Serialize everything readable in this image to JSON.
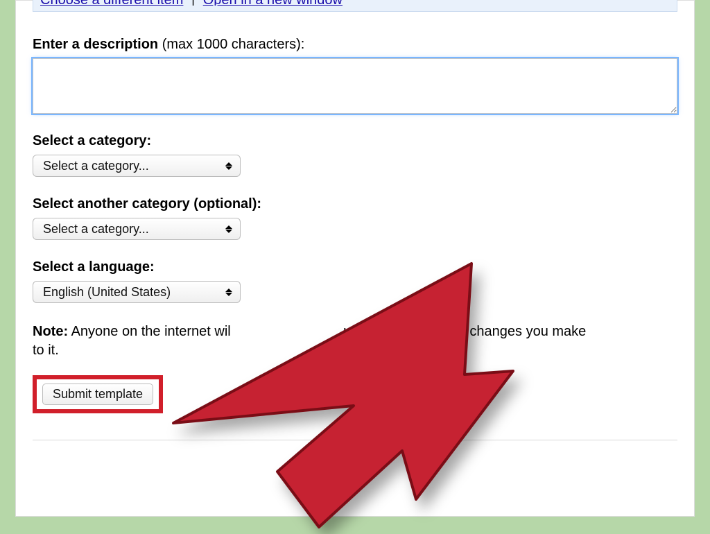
{
  "top_links": {
    "choose": "Choose a different item",
    "sep": "|",
    "open": "Open in a new window"
  },
  "description": {
    "label_bold": "Enter a description",
    "label_hint": " (max 1000 characters):",
    "value": ""
  },
  "category1": {
    "label": "Select a category:",
    "selected": "Select a category..."
  },
  "category2": {
    "label": "Select another category (optional):",
    "selected": "Select a category..."
  },
  "language": {
    "label": "Select a language:",
    "selected": "English (United States)"
  },
  "note": {
    "bold": "Note:",
    "text_before": " Anyone on the internet wil",
    "text_after": "ur template and any changes you make to it."
  },
  "submit": {
    "label": "Submit template"
  }
}
